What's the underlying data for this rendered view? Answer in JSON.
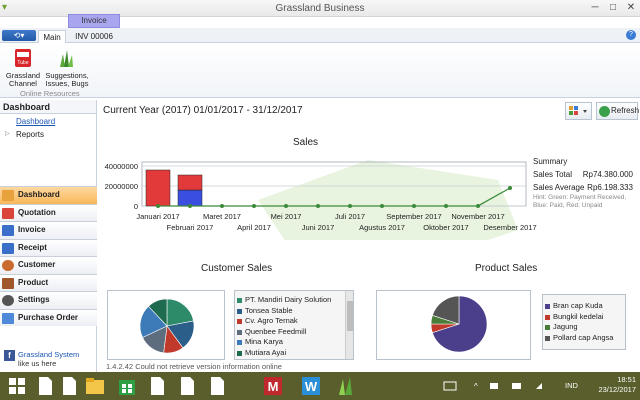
{
  "window": {
    "title": "Grassland Business",
    "context_tab_group": "Invoice"
  },
  "ribbon": {
    "tabs": [
      "Main",
      "INV 00006"
    ],
    "buttons": [
      {
        "label": "Grassland Channel",
        "icon": "youtube-icon"
      },
      {
        "label": "Suggestions, Issues, Bugs",
        "icon": "grass-icon"
      }
    ],
    "group_label": "Online Resources"
  },
  "left_panel": {
    "header": "Dashboard",
    "tree": [
      "Dashboard",
      "Reports"
    ],
    "nav": [
      {
        "label": "Dashboard",
        "icon": "dashboard-icon",
        "active": true,
        "color": "#e8a23c"
      },
      {
        "label": "Quotation",
        "icon": "quotation-icon",
        "active": false,
        "color": "#d9453a"
      },
      {
        "label": "Invoice",
        "icon": "invoice-icon",
        "active": false,
        "color": "#3a6fc9"
      },
      {
        "label": "Receipt",
        "icon": "receipt-icon",
        "active": false,
        "color": "#3a6fc9"
      },
      {
        "label": "Customer",
        "icon": "customer-icon",
        "active": false,
        "color": "#c96a2e"
      },
      {
        "label": "Product",
        "icon": "product-icon",
        "active": false,
        "color": "#a0552a"
      },
      {
        "label": "Settings",
        "icon": "settings-icon",
        "active": false,
        "color": "#555555"
      },
      {
        "label": "Purchase Order",
        "icon": "purchase-order-icon",
        "active": false,
        "color": "#4e8ad8"
      }
    ],
    "facebook": {
      "name": "Grassland System",
      "sub": "like us here"
    }
  },
  "main": {
    "period": "Current Year (2017) 01/01/2017 - 31/12/2017",
    "refresh_label": "Refresh",
    "sales_title": "Sales",
    "summary": {
      "title": "Summary",
      "total_label": "Sales Total",
      "total_value": "Rp74.380.000",
      "average_label": "Sales Average",
      "average_value": "Rp6.198.333",
      "hint": "Hint: Green: Payment Received, Blue: Paid, Red: Unpaid"
    },
    "customer_sales_title": "Customer Sales",
    "product_sales_title": "Product Sales",
    "customer_legend": [
      {
        "name": "PT. Mandiri Dairy Solution",
        "color": "#2e8b6a"
      },
      {
        "name": "Tonsea Stable",
        "color": "#2b5f8a"
      },
      {
        "name": "Cv. Agro Ternak",
        "color": "#c0392b"
      },
      {
        "name": "Quenbee Feedmill",
        "color": "#5d6d7e"
      },
      {
        "name": "Mina Karya",
        "color": "#3d7ab8"
      },
      {
        "name": "Mutiara Ayai",
        "color": "#1f6b4f"
      }
    ],
    "product_legend": [
      {
        "name": "Bran cap Kuda",
        "color": "#4b3e8a"
      },
      {
        "name": "Bungkil kedelai",
        "color": "#c0392b"
      },
      {
        "name": "Jagung",
        "color": "#4a7d3a"
      },
      {
        "name": "Pollard cap Angsa",
        "color": "#555555"
      }
    ],
    "version": "1.4.2.42  Could not retrieve version information online"
  },
  "taskbar": {
    "apps": [
      "windows-start-icon",
      "file-icon",
      "file-explorer-icon",
      "store-icon",
      "file-icon",
      "file-icon",
      "file-icon",
      "m-app-icon",
      "w-app-icon",
      "grassland-app-icon"
    ],
    "lang": "IND",
    "time": "18:51",
    "date": "23/12/2017"
  },
  "chart_data": [
    {
      "type": "bar",
      "title": "Sales",
      "categories": [
        "Januari 2017",
        "Februari 2017",
        "Maret 2017",
        "April 2017",
        "Mei 2017",
        "Juni 2017",
        "Juli 2017",
        "Agustus 2017",
        "September 2017",
        "Oktober 2017",
        "November 2017",
        "Desember 2017"
      ],
      "series": [
        {
          "name": "Unpaid",
          "color": "#e23a3a",
          "values": [
            36000000,
            31000000,
            0,
            0,
            0,
            0,
            0,
            0,
            0,
            0,
            0,
            0
          ]
        },
        {
          "name": "Paid",
          "color": "#3a4fe0",
          "values": [
            0,
            16000000,
            0,
            0,
            0,
            0,
            0,
            0,
            0,
            0,
            0,
            0
          ]
        },
        {
          "name": "Payment Received",
          "color": "#3a8a3a",
          "values": [
            0,
            0,
            0,
            0,
            0,
            0,
            0,
            0,
            0,
            0,
            0,
            18000000
          ]
        }
      ],
      "ylim": [
        0,
        40000000
      ],
      "yticks": [
        "40000000",
        "20000000",
        "0"
      ],
      "grid": true
    },
    {
      "type": "pie",
      "title": "Customer Sales",
      "labels": [
        "PT. Mandiri Dairy Solution",
        "Tonsea Stable",
        "Cv. Agro Ternak",
        "Quenbee Feedmill",
        "Mina Karya",
        "Mutiara Ayai"
      ],
      "values": [
        22,
        18,
        12,
        16,
        20,
        12
      ]
    },
    {
      "type": "pie",
      "title": "Product Sales",
      "labels": [
        "Bran cap Kuda",
        "Bungkil kedelai",
        "Jagung",
        "Pollard cap Angsa"
      ],
      "values": [
        70,
        5,
        5,
        20
      ]
    }
  ]
}
